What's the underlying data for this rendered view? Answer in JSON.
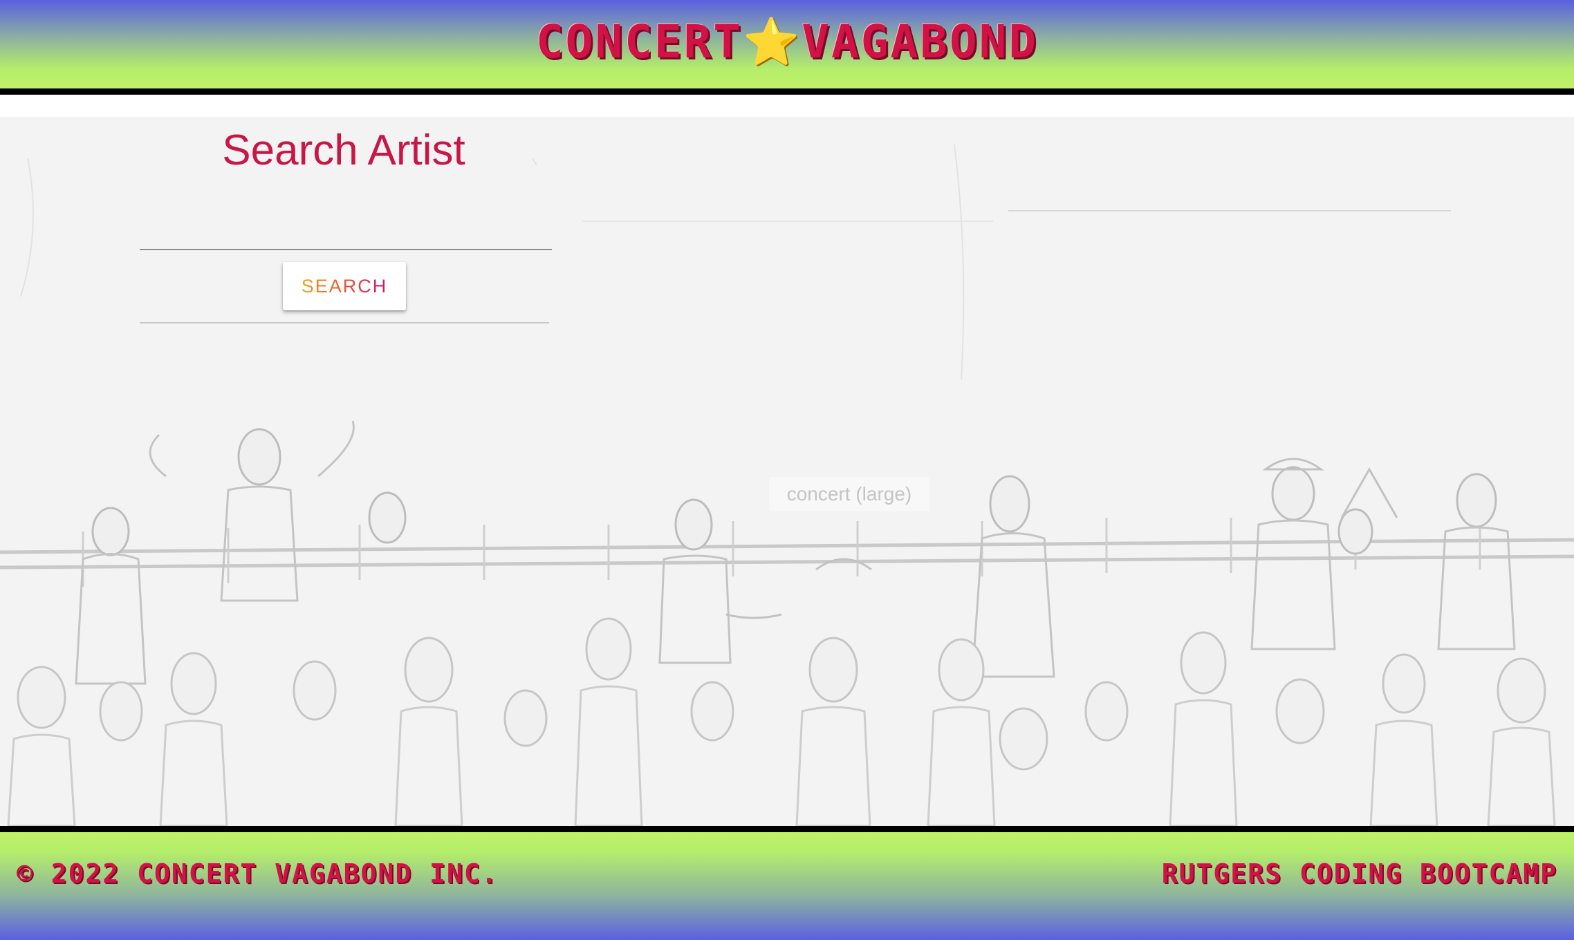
{
  "header": {
    "brand_left": "CONCERT",
    "brand_star": "⭐",
    "brand_right": "VAGABOND"
  },
  "search": {
    "title": "Search Artist",
    "input_value": "",
    "button_label": "SEARCH"
  },
  "hero_image": {
    "alt_text": "concert (large)"
  },
  "footer": {
    "left_text": "© 2022 CONCERT VAGABOND INC.",
    "right_text": "RUTGERS CODING BOOTCAMP"
  },
  "colors": {
    "brand_red": "#d01245",
    "title_red": "#c81747",
    "gradient_blue": "#5a60e2",
    "gradient_green": "#bff06a"
  }
}
